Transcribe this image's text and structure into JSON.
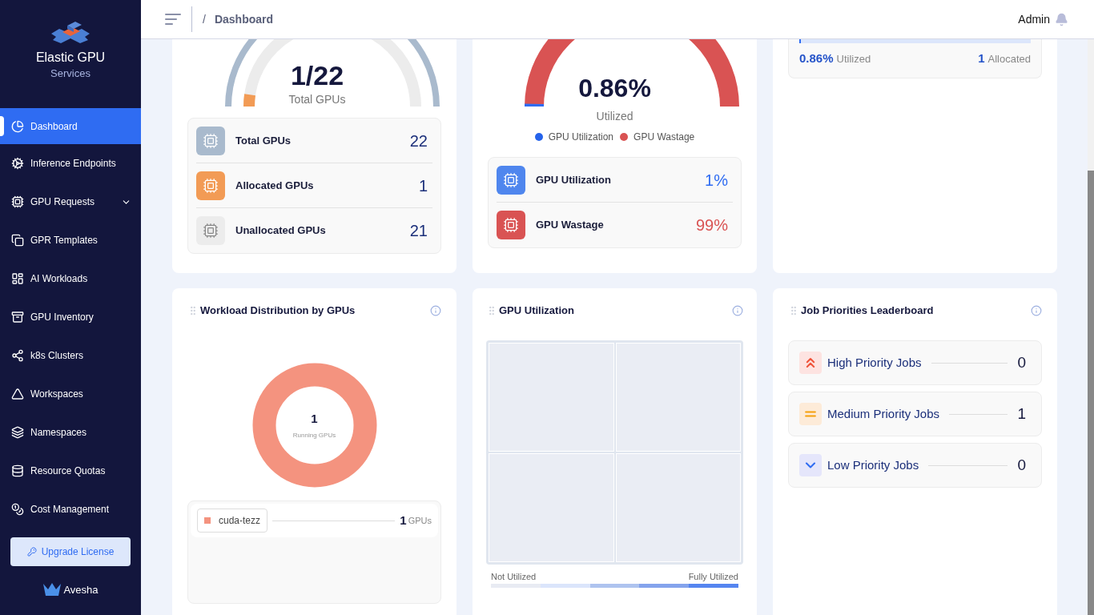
{
  "sidebar": {
    "brand": {
      "title": "Elastic GPU",
      "subtitle": "Services"
    },
    "items": [
      {
        "label": "Dashboard",
        "selected": true,
        "expandable": false
      },
      {
        "label": "Inference Endpoints",
        "selected": false,
        "expandable": false
      },
      {
        "label": "GPU Requests",
        "selected": false,
        "expandable": true
      },
      {
        "label": "GPR Templates",
        "selected": false,
        "expandable": false
      },
      {
        "label": "AI Workloads",
        "selected": false,
        "expandable": false
      },
      {
        "label": "GPU Inventory",
        "selected": false,
        "expandable": false
      },
      {
        "label": "k8s Clusters",
        "selected": false,
        "expandable": false
      },
      {
        "label": "Workspaces",
        "selected": false,
        "expandable": false
      },
      {
        "label": "Namespaces",
        "selected": false,
        "expandable": false
      },
      {
        "label": "Resource Quotas",
        "selected": false,
        "expandable": false
      },
      {
        "label": "Cost Management",
        "selected": false,
        "expandable": false
      }
    ],
    "upgrade_button": "Upgrade License",
    "footer_logo": "Avesha"
  },
  "header": {
    "breadcrumb_separator": "/",
    "breadcrumb": "Dashboard",
    "user": "Admin"
  },
  "gpu_summary": {
    "gauge": {
      "value": "1/22",
      "caption": "Total GPUs",
      "level": 0.045
    },
    "stats": [
      {
        "kind": "total",
        "label": "Total GPUs",
        "value": "22"
      },
      {
        "kind": "allocated",
        "label": "Allocated GPUs",
        "value": "1"
      },
      {
        "kind": "unallocated",
        "label": "Unallocated GPUs",
        "value": "21"
      }
    ]
  },
  "utilization_summary": {
    "gauge": {
      "value": "0.86%",
      "caption": "Utilized",
      "level": 0.0086
    },
    "legend": [
      {
        "label": "GPU Utilization",
        "color": "#2563eb"
      },
      {
        "label": "GPU Wastage",
        "color": "#d95353"
      }
    ],
    "stats": [
      {
        "kind": "utilization",
        "label": "GPU Utilization",
        "value": "1%"
      },
      {
        "kind": "wastage",
        "label": "GPU Wastage",
        "value": "99%"
      }
    ]
  },
  "allocation_card": {
    "level": 0.0086,
    "utilized_value": "0.86%",
    "utilized_label": "Utilized",
    "allocated_value": "1",
    "allocated_label": "Allocated"
  },
  "workload_distribution": {
    "title": "Workload Distribution by GPUs",
    "total": "1",
    "total_caption": "Running GPUs",
    "items": [
      {
        "name": "cuda-tezz",
        "value": "1",
        "unit": "GPUs",
        "color": "#f4937f"
      }
    ]
  },
  "gpu_utilization": {
    "title": "GPU Utilization",
    "legend_min": "Not Utilized",
    "legend_max": "Fully Utilized"
  },
  "job_priorities": {
    "title": "Job Priorities Leaderboard",
    "items": [
      {
        "kind": "high",
        "label": "High Priority Jobs",
        "count": "0"
      },
      {
        "kind": "medium",
        "label": "Medium Priority Jobs",
        "count": "1"
      },
      {
        "kind": "low",
        "label": "Low Priority Jobs",
        "count": "0"
      }
    ]
  }
}
